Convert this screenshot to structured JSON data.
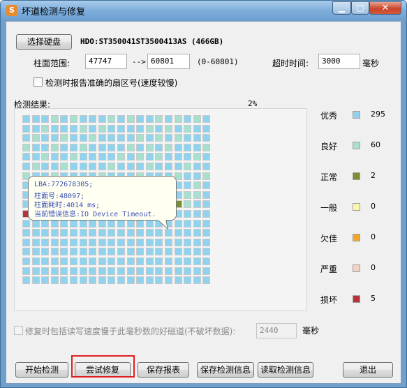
{
  "window": {
    "title": "坏道检测与修复",
    "app_icon": "S",
    "controls": {
      "minimize": "▁",
      "maximize": "□",
      "close": "✕"
    }
  },
  "disk": {
    "select_button": "选择硬盘",
    "name": "HDO:ST350041ST3500413AS (466GB)"
  },
  "range": {
    "label": "柱面范围:",
    "from": "47747",
    "arrow": "-->",
    "to": "60801",
    "hint": "(0-60801)"
  },
  "timeout": {
    "label": "超时时间:",
    "value": "3000",
    "unit": "毫秒"
  },
  "report_option": {
    "label": "检测时报告准确的扇区号(速度较慢)",
    "checked": false
  },
  "result": {
    "label": "检测结果:",
    "progress": "2%"
  },
  "legend": [
    {
      "label": "优秀",
      "count": "295",
      "color": "#8fd3ee"
    },
    {
      "label": "良好",
      "count": "60",
      "color": "#a8e0d0"
    },
    {
      "label": "正常",
      "count": "2",
      "color": "#7b8f2e"
    },
    {
      "label": "一般",
      "count": "0",
      "color": "#fcf7a8"
    },
    {
      "label": "欠佳",
      "count": "0",
      "color": "#f4a62a"
    },
    {
      "label": "严重",
      "count": "0",
      "color": "#f2d2c2"
    },
    {
      "label": "损坏",
      "count": "5",
      "color": "#b9323a"
    }
  ],
  "tooltip": {
    "lines": [
      "LBA:772678305;",
      "柱面号:48097;",
      "柱面耗时:4014 ms;",
      "当前错误信息:IO Device Timeout."
    ]
  },
  "repair_option": {
    "label": "修复时包括读写速度慢于此毫秒数的好磁道(不破坏数据):",
    "value": "2440",
    "unit": "毫秒",
    "checked": false
  },
  "buttons": {
    "start": "开始检测",
    "repair": "尝试修复",
    "save_report": "保存报表",
    "save_info": "保存检测信息",
    "load_info": "读取检测信息",
    "exit": "退出"
  },
  "grid": {
    "columns": 20,
    "rows": 18,
    "cells_shown": 362,
    "damaged_cells": [
      182,
      183,
      184,
      191,
      200
    ],
    "normal_cells": [
      196,
      208
    ],
    "good_cells": [
      5,
      9,
      14,
      18,
      22,
      28,
      33,
      37,
      41,
      47,
      52,
      56,
      60,
      66,
      71,
      75,
      79,
      85,
      90,
      94,
      98,
      104,
      109,
      113,
      117,
      123,
      128,
      132,
      136,
      142,
      147,
      151,
      155,
      161,
      166,
      170,
      174,
      178,
      186,
      189,
      193,
      197,
      203,
      206,
      11,
      26,
      44,
      63,
      82,
      101,
      120,
      139,
      158,
      177,
      3,
      16,
      35,
      54,
      73,
      92
    ]
  }
}
